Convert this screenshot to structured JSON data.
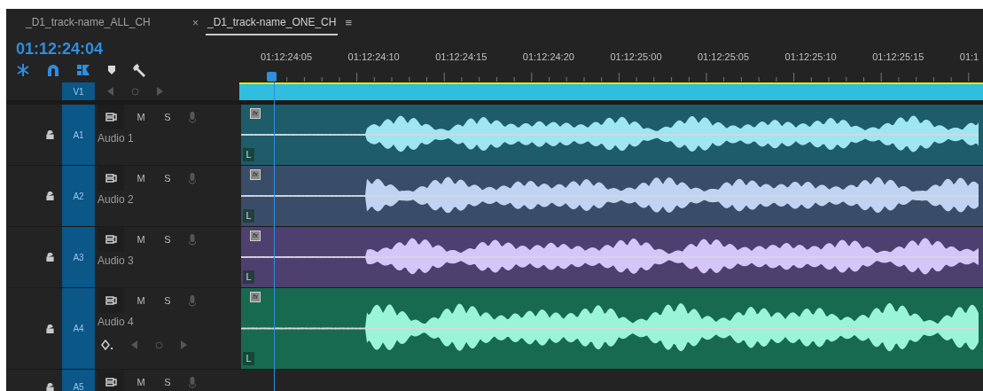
{
  "tabs": [
    {
      "label": "_D1_track-name_ALL_CH",
      "selected": false
    },
    {
      "label": "_D1_track-name_ONE_CH",
      "selected": true,
      "close": "×",
      "menu": "≡"
    }
  ],
  "timecode": "01:12:24:04",
  "ruler": {
    "labels": [
      "01:12:24:05",
      "01:12:24:10",
      "01:12:24:15",
      "01:12:24:20",
      "01:12:25:00",
      "01:12:25:05",
      "01:12:25:10",
      "01:12:25:15",
      "01:1"
    ]
  },
  "video_tracks": [
    {
      "label": "V1"
    }
  ],
  "audio_tracks": [
    {
      "label": "A1",
      "name": "Audio 1",
      "mute": "M",
      "solo": "S",
      "keyframes": false,
      "clip": {
        "color": "#1d5c68",
        "channel": "L",
        "fx": "fx"
      }
    },
    {
      "label": "A2",
      "name": "Audio 2",
      "mute": "M",
      "solo": "S",
      "keyframes": false,
      "clip": {
        "color": "#3a4d68",
        "channel": "L",
        "fx": "fx"
      }
    },
    {
      "label": "A3",
      "name": "Audio 3",
      "mute": "M",
      "solo": "S",
      "keyframes": false,
      "clip": {
        "color": "#4e406e",
        "channel": "L",
        "fx": "fx"
      }
    },
    {
      "label": "A4",
      "name": "Audio 4",
      "mute": "M",
      "solo": "S",
      "keyframes": true,
      "clip": {
        "color": "#176a50",
        "channel": "L",
        "fx": "fx"
      }
    },
    {
      "label": "A5",
      "mute": "M",
      "solo": "S",
      "keyframes": false
    }
  ]
}
